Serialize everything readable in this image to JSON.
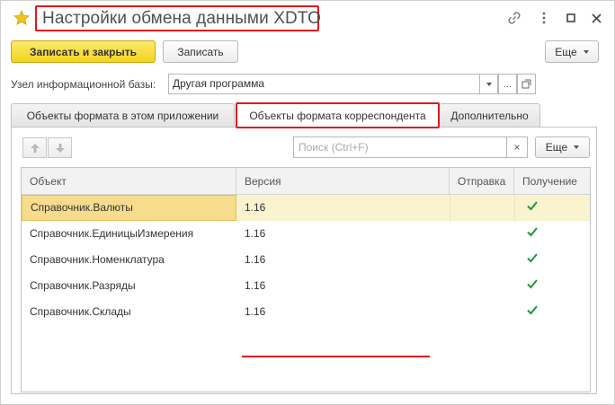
{
  "window": {
    "title": "Настройки обмена данными XDTO"
  },
  "icons": {
    "favorite": "star-icon",
    "link": "link-icon",
    "more": "more-vertical-icon",
    "maximize": "maximize-icon",
    "close": "close-icon"
  },
  "colors": {
    "accent_yellow": "#f4d21f",
    "highlight_red": "#e0161d",
    "check_green": "#1a9a3a",
    "selected_row": "#faf3d0"
  },
  "toolbar": {
    "save_close_label": "Записать и закрыть",
    "save_label": "Записать",
    "more_label": "Еще"
  },
  "node": {
    "label": "Узел информационной базы:",
    "value": "Другая программа",
    "select_glyph": "...",
    "open_icon": "open-icon"
  },
  "tabs": [
    {
      "label": "Объекты формата в этом приложении",
      "active": false
    },
    {
      "label": "Объекты формата корреспондента",
      "active": true
    },
    {
      "label": "Дополнительно",
      "active": false
    }
  ],
  "panel": {
    "search_placeholder": "Поиск (Ctrl+F)",
    "clear_glyph": "×",
    "more_label": "Еще"
  },
  "table": {
    "columns": [
      "Объект",
      "Версия",
      "Отправка",
      "Получение"
    ],
    "rows": [
      {
        "object": "Справочник.Валюты",
        "version": "1.16",
        "send": false,
        "receive": true,
        "selected": true
      },
      {
        "object": "Справочник.ЕдиницыИзмерения",
        "version": "1.16",
        "send": false,
        "receive": true,
        "selected": false
      },
      {
        "object": "Справочник.Номенклатура",
        "version": "1.16",
        "send": false,
        "receive": true,
        "selected": false
      },
      {
        "object": "Справочник.Разряды",
        "version": "1.16",
        "send": false,
        "receive": true,
        "selected": false
      },
      {
        "object": "Справочник.Склады",
        "version": "1.16",
        "send": false,
        "receive": true,
        "selected": false
      }
    ]
  }
}
